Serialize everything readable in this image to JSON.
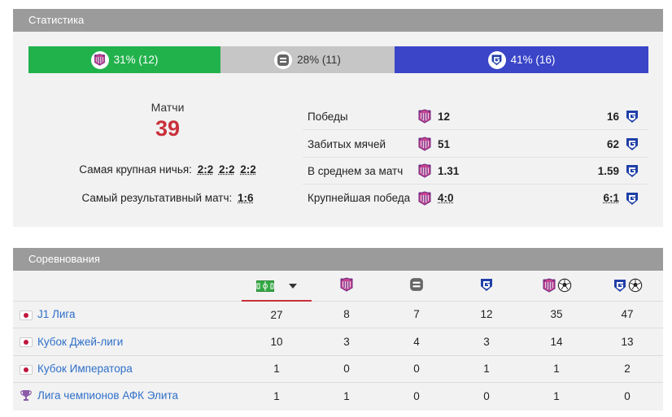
{
  "stats": {
    "header": "Статистика",
    "bar": {
      "home_label": "31% (12)",
      "draw_label": "28% (11)",
      "away_label": "41% (16)",
      "home_color": "#22b24c",
      "draw_color": "#c6c6c6",
      "away_color": "#3a45c8"
    },
    "matches_label": "Матчи",
    "matches_value": "39",
    "biggest_draw_label": "Самая крупная ничья:",
    "biggest_draw_scores": [
      "2:2",
      "2:2",
      "2:2"
    ],
    "most_goals_label": "Самый результативный матч:",
    "most_goals_score": "1:6",
    "comparison": [
      {
        "label": "Победы",
        "home": "12",
        "away": "16"
      },
      {
        "label": "Забитых мячей",
        "home": "51",
        "away": "62"
      },
      {
        "label": "В среднем за матч",
        "home": "1.31",
        "away": "1.59"
      },
      {
        "label": "Крупнейшая победа",
        "home": "4:0",
        "away": "6:1"
      }
    ]
  },
  "competitions": {
    "header": "Соревнования",
    "columns": [
      "matches-field-icon",
      "home-team-crest",
      "draw-icon",
      "away-team-crest",
      "home-goals-icon",
      "away-goals-icon"
    ],
    "rows": [
      {
        "name": "J1 Лига",
        "flag": "japan-flag-icon",
        "values": [
          "27",
          "8",
          "7",
          "12",
          "35",
          "47"
        ]
      },
      {
        "name": "Кубок Джей-лиги",
        "flag": "japan-flag-icon",
        "values": [
          "10",
          "3",
          "4",
          "3",
          "14",
          "13"
        ]
      },
      {
        "name": "Кубок Императора",
        "flag": "japan-flag-icon",
        "values": [
          "1",
          "0",
          "0",
          "1",
          "1",
          "2"
        ]
      },
      {
        "name": "Лига чемпионов АФК Элита",
        "flag": "trophy-icon",
        "values": [
          "1",
          "1",
          "0",
          "0",
          "1",
          "0"
        ]
      }
    ]
  }
}
